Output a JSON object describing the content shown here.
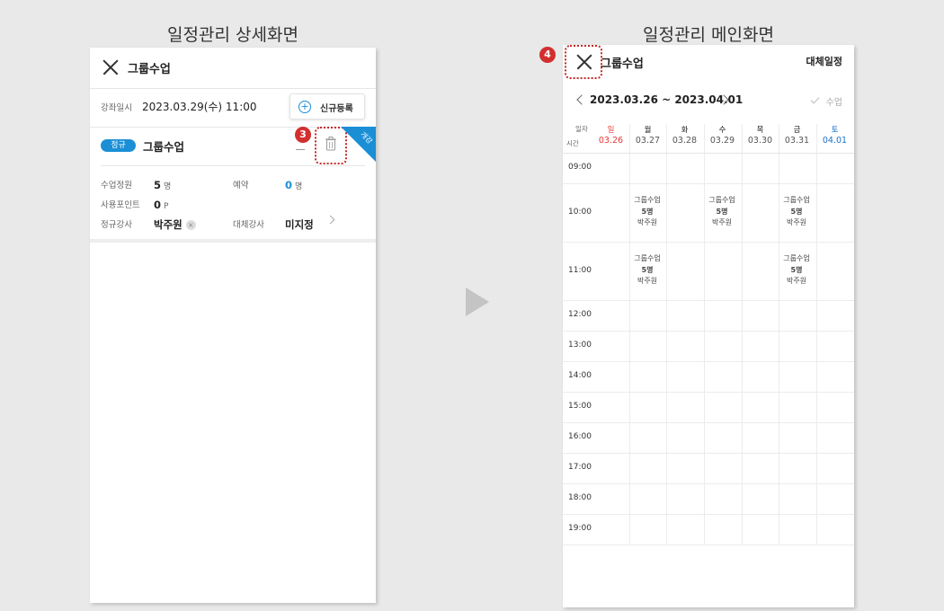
{
  "captions": {
    "left": "일정관리 상세화면",
    "right": "일정관리 메인화면"
  },
  "detail": {
    "title": "그룹수업",
    "datetime_label": "강좌일시",
    "datetime_value": "2023.03.29(수) 11:00",
    "new_button": "신규등록",
    "badge": "정규",
    "class_name": "그룹수업",
    "ribbon": "개강",
    "capacity_label": "수업정원",
    "capacity_value": "5",
    "capacity_unit": "명",
    "reservation_label": "예약",
    "reservation_value": "0",
    "reservation_unit": "명",
    "points_label": "사용포인트",
    "points_value": "0",
    "points_unit": "P",
    "instructor_label": "정규강사",
    "instructor_value": "박주원",
    "substitute_label": "대체강사",
    "substitute_value": "미지정",
    "step_badge": "3"
  },
  "main": {
    "title": "그룹수업",
    "substitute_schedule": "대체일정",
    "range": "2023.03.26 ~ 2023.04.01",
    "class_filter": "수업",
    "corner_date": "일자",
    "corner_time": "시간",
    "step_badge": "4",
    "days": [
      {
        "name": "일",
        "date": "03.26",
        "type": "sun"
      },
      {
        "name": "월",
        "date": "03.27",
        "type": ""
      },
      {
        "name": "화",
        "date": "03.28",
        "type": ""
      },
      {
        "name": "수",
        "date": "03.29",
        "type": ""
      },
      {
        "name": "목",
        "date": "03.30",
        "type": ""
      },
      {
        "name": "금",
        "date": "03.31",
        "type": ""
      },
      {
        "name": "토",
        "date": "04.01",
        "type": "sat"
      }
    ],
    "times": [
      "09:00",
      "10:00",
      "11:00",
      "12:00",
      "13:00",
      "14:00",
      "15:00",
      "16:00",
      "17:00",
      "18:00",
      "19:00"
    ],
    "events": [
      {
        "time": "10:00",
        "day": 1,
        "name": "그룹수업",
        "count": "5명",
        "teacher": "박주원"
      },
      {
        "time": "10:00",
        "day": 3,
        "name": "그룹수업",
        "count": "5명",
        "teacher": "박주원"
      },
      {
        "time": "10:00",
        "day": 5,
        "name": "그룹수업",
        "count": "5명",
        "teacher": "박주원"
      },
      {
        "time": "11:00",
        "day": 1,
        "name": "그룹수업",
        "count": "5명",
        "teacher": "박주원"
      },
      {
        "time": "11:00",
        "day": 5,
        "name": "그룹수업",
        "count": "5명",
        "teacher": "박주원"
      }
    ]
  }
}
